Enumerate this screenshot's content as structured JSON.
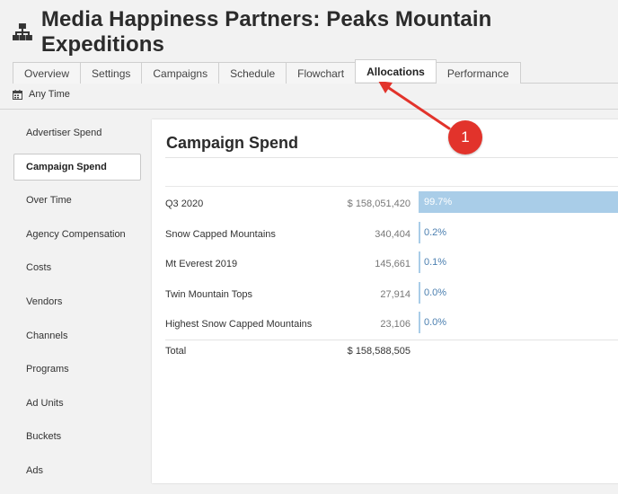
{
  "header": {
    "title": "Media Happiness Partners: Peaks Mountain Expeditions",
    "icon": "org-chart-icon"
  },
  "tabs": [
    {
      "label": "Overview",
      "active": false
    },
    {
      "label": "Settings",
      "active": false
    },
    {
      "label": "Campaigns",
      "active": false
    },
    {
      "label": "Schedule",
      "active": false
    },
    {
      "label": "Flowchart",
      "active": false
    },
    {
      "label": "Allocations",
      "active": true
    },
    {
      "label": "Performance",
      "active": false
    }
  ],
  "date_range": {
    "icon": "calendar-icon",
    "label": "Any Time"
  },
  "sidebar": {
    "items": [
      {
        "label": "Advertiser Spend",
        "active": false
      },
      {
        "label": "Campaign Spend",
        "active": true
      },
      {
        "label": "Over Time",
        "active": false
      },
      {
        "label": "Agency Compensation",
        "active": false
      },
      {
        "label": "Costs",
        "active": false
      },
      {
        "label": "Vendors",
        "active": false
      },
      {
        "label": "Channels",
        "active": false
      },
      {
        "label": "Programs",
        "active": false
      },
      {
        "label": "Ad Units",
        "active": false
      },
      {
        "label": "Buckets",
        "active": false
      },
      {
        "label": "Ads",
        "active": false
      }
    ]
  },
  "panel": {
    "title": "Campaign Spend",
    "rows": [
      {
        "name": "Q3 2020",
        "amount": "$ 158,051,420",
        "percent_label": "99.7%",
        "share": 0.997
      },
      {
        "name": "Snow Capped Mountains",
        "amount": "340,404",
        "percent_label": "0.2%",
        "share": 0.002
      },
      {
        "name": "Mt Everest 2019",
        "amount": "145,661",
        "percent_label": "0.1%",
        "share": 0.001
      },
      {
        "name": "Twin Mountain Tops",
        "amount": "27,914",
        "percent_label": "0.0%",
        "share": 0.0
      },
      {
        "name": "Highest Snow Capped Mountains",
        "amount": "23,106",
        "percent_label": "0.0%",
        "share": 0.0
      }
    ],
    "total": {
      "label": "Total",
      "amount": "$ 158,588,505"
    }
  },
  "annotation": {
    "badge_number": "1",
    "color": "#e2332b"
  },
  "colors": {
    "bar": "#a9cde8",
    "accent": "#e2332b"
  }
}
